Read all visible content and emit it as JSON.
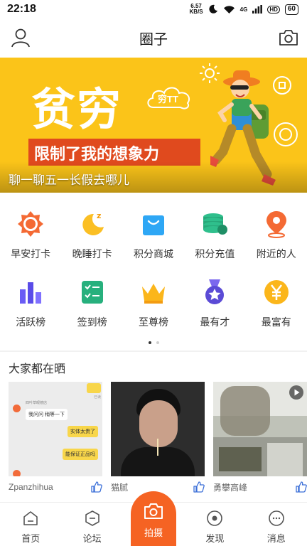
{
  "status_bar": {
    "time": "22:18",
    "speed_value": "6.57",
    "speed_unit": "KB/S",
    "network": "4G",
    "hd": "HD",
    "battery": "60"
  },
  "header": {
    "title": "圈子",
    "left_icon": "user-icon",
    "right_icon": "camera-icon"
  },
  "banner": {
    "headline": "贫穷",
    "subline": "限制了我的想象力",
    "bubble_text": "穷TT",
    "caption": "聊一聊五一长假去哪儿",
    "bg_color": "#fbc419"
  },
  "grid": {
    "row1": [
      {
        "label": "早安打卡",
        "icon": "sun-icon"
      },
      {
        "label": "晚睡打卡",
        "icon": "moon-icon"
      },
      {
        "label": "积分商城",
        "icon": "shopping-bag-icon"
      },
      {
        "label": "积分充值",
        "icon": "coins-icon"
      },
      {
        "label": "附近的人",
        "icon": "location-pin-icon"
      }
    ],
    "row2": [
      {
        "label": "活跃榜",
        "icon": "bar-chart-icon"
      },
      {
        "label": "签到榜",
        "icon": "checklist-icon"
      },
      {
        "label": "至尊榜",
        "icon": "crown-icon"
      },
      {
        "label": "最有才",
        "icon": "medal-icon"
      },
      {
        "label": "最富有",
        "icon": "yen-coin-icon"
      }
    ]
  },
  "section": {
    "title": "大家都在晒"
  },
  "chat_card": {
    "shop_name": "四叶草眼镜店",
    "msg1": "我问问 稍等一下",
    "msg2": "实体太贵了",
    "msg3": "能保证正品吗",
    "read": "已读"
  },
  "cards": [
    {
      "user": "Zpanzhihua",
      "icon": "thumbs-up-icon"
    },
    {
      "user": "猫腻",
      "icon": "thumbs-up-icon"
    },
    {
      "user": "勇攀高峰",
      "icon": "thumbs-up-icon"
    }
  ],
  "bottom_nav": {
    "home": "首页",
    "forum": "论坛",
    "shoot": "拍摄",
    "discover": "发现",
    "messages": "消息",
    "accent": "#f56323"
  }
}
